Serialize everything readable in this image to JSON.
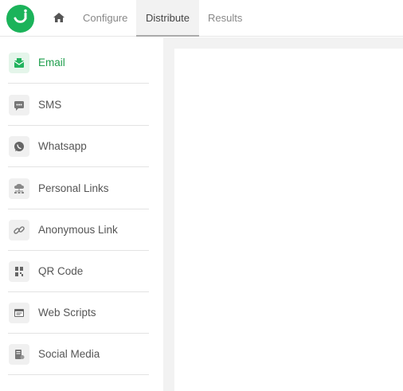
{
  "header": {
    "tabs": [
      {
        "label": "Configure"
      },
      {
        "label": "Distribute"
      },
      {
        "label": "Results"
      }
    ],
    "active_tab": "Distribute"
  },
  "sidebar": {
    "items": [
      {
        "label": "Email",
        "icon": "email-icon",
        "active": true
      },
      {
        "label": "SMS",
        "icon": "sms-icon"
      },
      {
        "label": "Whatsapp",
        "icon": "whatsapp-icon"
      },
      {
        "label": "Personal Links",
        "icon": "personal-links-icon"
      },
      {
        "label": "Anonymous Link",
        "icon": "link-icon"
      },
      {
        "label": "QR Code",
        "icon": "qr-code-icon"
      },
      {
        "label": "Web Scripts",
        "icon": "web-scripts-icon"
      },
      {
        "label": "Social Media",
        "icon": "social-media-icon"
      }
    ]
  },
  "colors": {
    "brand": "#1bb35a",
    "active_text": "#1e9e4c",
    "content_bg": "#f2f2f2"
  }
}
